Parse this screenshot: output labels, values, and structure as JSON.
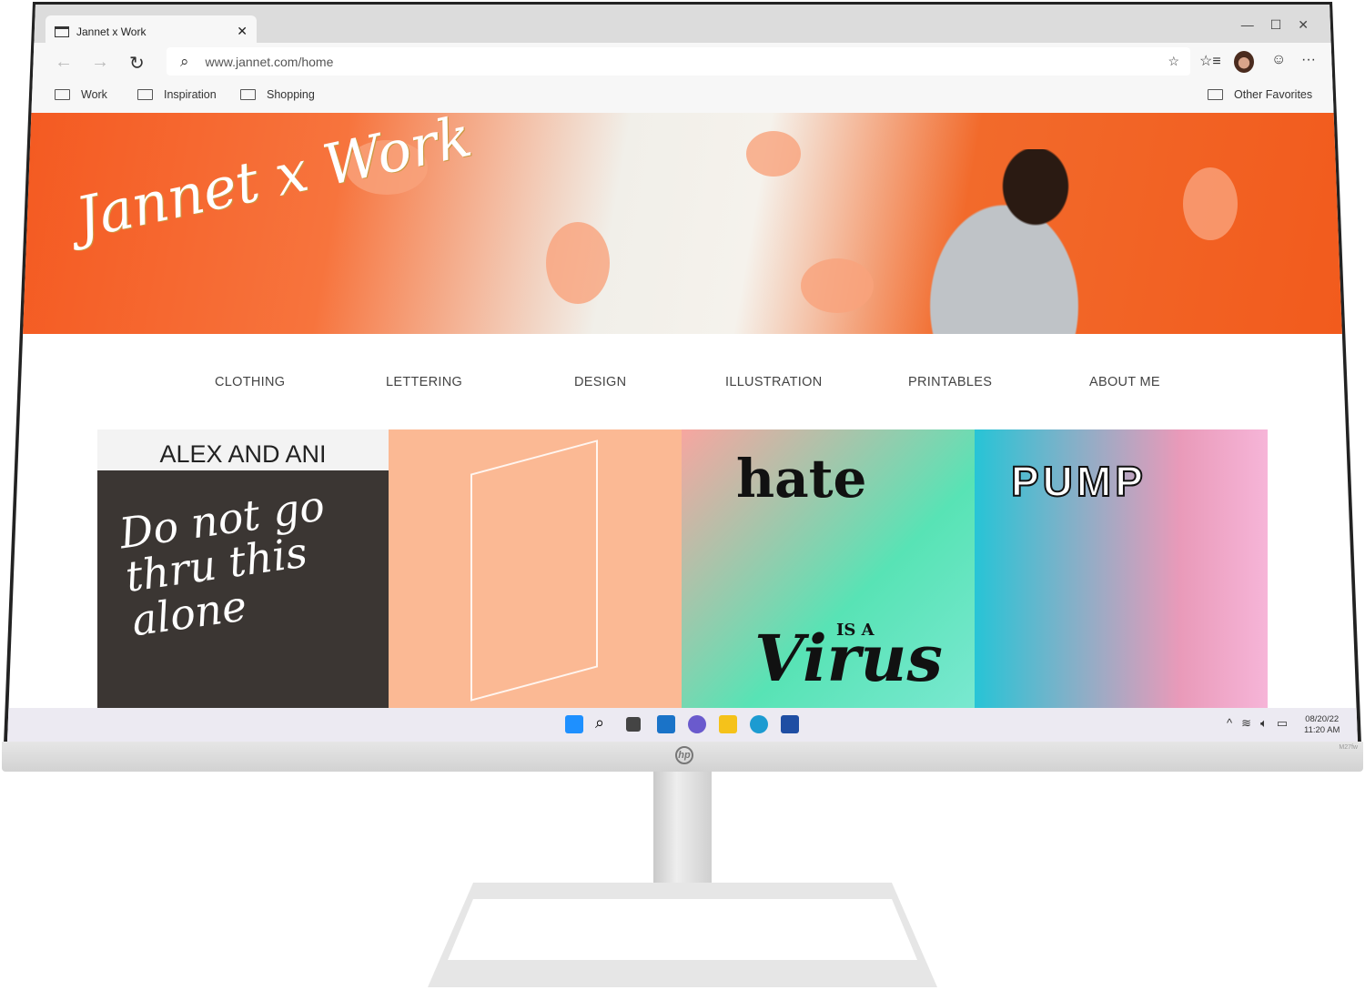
{
  "browser": {
    "tab_title": "Jannet x Work",
    "url": "www.jannet.com/home",
    "favorites": [
      "Work",
      "Inspiration",
      "Shopping"
    ],
    "other_favorites": "Other Favorites"
  },
  "site": {
    "logo": "Jannet x Work",
    "nav": [
      "CLOTHING",
      "LETTERING",
      "DESIGN",
      "ILLUSTRATION",
      "PRINTABLES",
      "ABOUT ME"
    ],
    "tiles": {
      "t1_heading": "ALEX AND ANI",
      "t1_art": "Do not go thru this alone",
      "t3_art": [
        "hate",
        "IS A",
        "Virus"
      ],
      "t4_art": "PUMP"
    },
    "accent": "#f4581f"
  },
  "taskbar": {
    "date": "08/20/22",
    "time": "11:20 AM"
  },
  "monitor": {
    "brand": "hp",
    "model": "M27fw"
  }
}
